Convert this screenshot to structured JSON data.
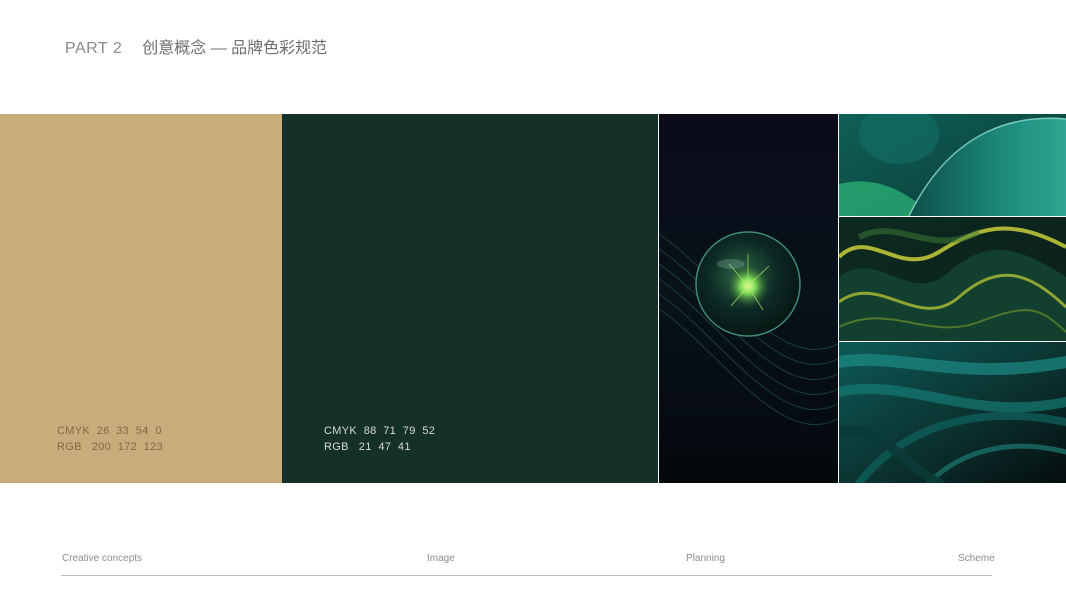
{
  "header": {
    "part": "PART 2",
    "title": "创意概念 — 品牌色彩规范"
  },
  "colors": [
    {
      "hex": "#c8ac7b",
      "cmyk": "CMYK  26  33  54  0",
      "rgb": "RGB   200  172  123",
      "label_color": "#7d6a49"
    },
    {
      "hex": "#152f29",
      "cmyk": "CMYK  88  71  79  52",
      "rgb": "RGB   21  47  41",
      "label_color": "#d9d9d9"
    }
  ],
  "images": [
    {
      "icon": "crystal-orb-image"
    },
    {
      "icon": "teal-arc-image"
    },
    {
      "icon": "gold-green-wave-image"
    },
    {
      "icon": "teal-ribbon-image"
    }
  ],
  "footer": {
    "items": [
      "Creative concepts",
      "Image",
      "Planning",
      "Scheme"
    ]
  }
}
